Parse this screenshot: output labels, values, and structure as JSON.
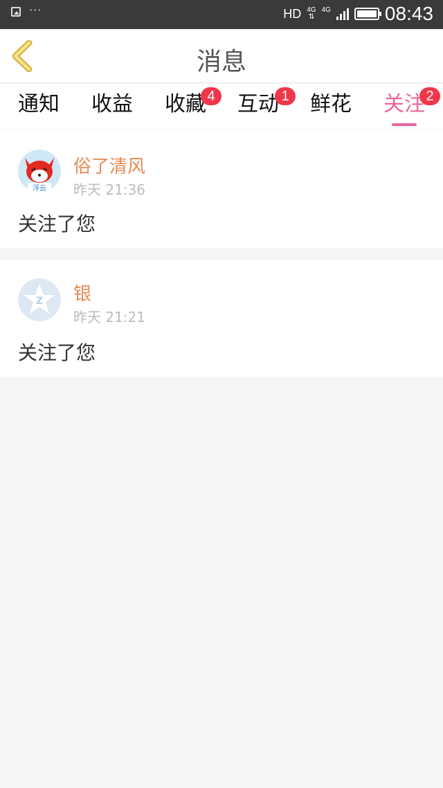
{
  "status_bar": {
    "network_type": "HD",
    "net_label_1": "4G",
    "net_label_2": "4G",
    "time": "08:43"
  },
  "header": {
    "title": "消息"
  },
  "tabs": [
    {
      "label": "通知",
      "badge": null,
      "active": false
    },
    {
      "label": "收益",
      "badge": null,
      "active": false
    },
    {
      "label": "收藏",
      "badge": "4",
      "active": false
    },
    {
      "label": "互动",
      "badge": "1",
      "active": false
    },
    {
      "label": "鲜花",
      "badge": null,
      "active": false
    },
    {
      "label": "关注",
      "badge": "2",
      "active": true
    }
  ],
  "messages": [
    {
      "name": "俗了清风",
      "time": "昨天 21:36",
      "text": "关注了您",
      "avatar": "cartoon-fox-avatar"
    },
    {
      "name": "银",
      "time": "昨天 21:21",
      "text": "关注了您",
      "avatar": "default-star-avatar"
    }
  ],
  "colors": {
    "accent": "#e8669a",
    "badge": "#f0374a",
    "name": "#e98a55",
    "background": "#f6f6f6"
  }
}
